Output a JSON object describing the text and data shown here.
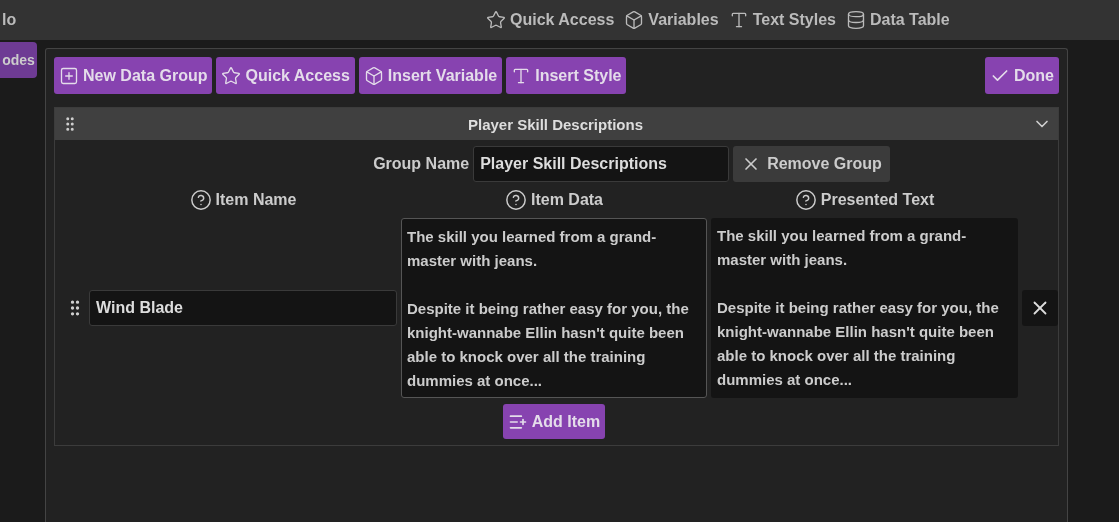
{
  "topbar": {
    "left_text": "lo",
    "nav": [
      {
        "label": "Quick Access"
      },
      {
        "label": "Variables"
      },
      {
        "label": "Text Styles"
      },
      {
        "label": "Data Table"
      }
    ]
  },
  "behind": {
    "button": "odes"
  },
  "modal": {
    "toolbar": [
      {
        "label": "New Data Group"
      },
      {
        "label": "Quick Access"
      },
      {
        "label": "Insert Variable"
      },
      {
        "label": "Insert Style"
      }
    ],
    "done": {
      "label": "Done"
    },
    "group": {
      "title": "Player Skill Descriptions",
      "expanded": true,
      "name_label": "Group Name",
      "name_value": "Player Skill Descriptions",
      "remove": "Remove Group",
      "columns": [
        "Item Name",
        "Item Data",
        "Presented Text"
      ],
      "items": [
        {
          "name": "Wind Blade",
          "data": "The skill you learned from a grand-master with jeans.\n\nDespite it being rather easy for you, the knight-wannabe Ellin hasn't quite been able to knock over all the training dummies at once...",
          "presented": "The skill you learned from a grand-master with jeans.\n\nDespite it being rather easy for you, the knight-wannabe Ellin hasn't quite been able to knock over all the training dummies at once..."
        }
      ],
      "add_item": "Add Item"
    }
  }
}
